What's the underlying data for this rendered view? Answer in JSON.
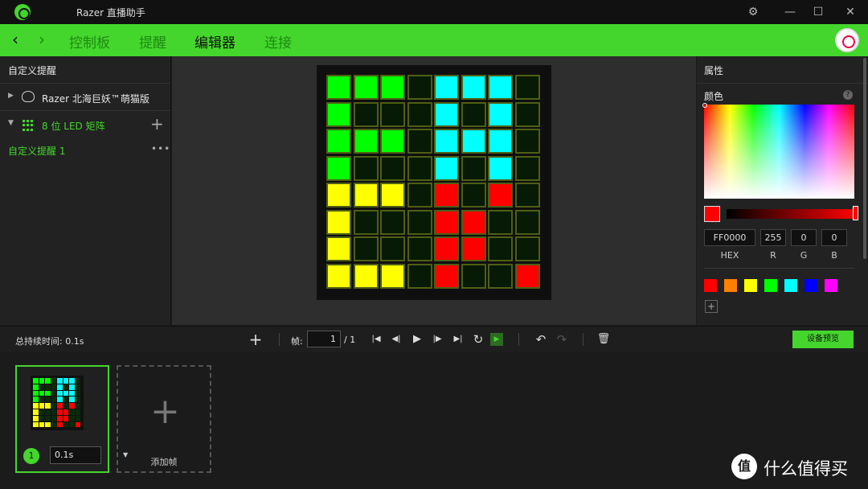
{
  "window": {
    "title": "Razer 直播助手",
    "controls": [
      "settings",
      "minimize",
      "maximize",
      "close"
    ]
  },
  "nav": {
    "tabs": [
      {
        "label": "控制板",
        "active": false
      },
      {
        "label": "提醒",
        "active": false
      },
      {
        "label": "编辑器",
        "active": true
      },
      {
        "label": "连接",
        "active": false
      }
    ]
  },
  "left_panel": {
    "header": "自定义提醒",
    "device": "Razer 北海巨妖™萌猫版",
    "matrix": "8 位 LED 矩阵",
    "alert": "自定义提醒 1"
  },
  "led_matrix": {
    "palette": {
      "G": "#00ff00",
      "C": "#00ffff",
      "Y": "#ffff00",
      "R": "#ff0000",
      "O": "#061a06"
    },
    "rows": [
      "GGGOCCCO",
      "GOOOCOCO",
      "GGGOCCCO",
      "GOOOCOCO",
      "YYYORORO",
      "YOOORROO",
      "YOOORROO",
      "YYYOROOR"
    ]
  },
  "right_panel": {
    "title": "属性",
    "color_label": "颜色",
    "help": "?",
    "current_color": "#ff0000",
    "hex": {
      "value": "FF0000",
      "label": "HEX"
    },
    "r": {
      "value": "255",
      "label": "R"
    },
    "g": {
      "value": "0",
      "label": "G"
    },
    "b": {
      "value": "0",
      "label": "B"
    },
    "presets": [
      "#ff0000",
      "#ff8000",
      "#ffff00",
      "#00ff00",
      "#00ffff",
      "#0000ff",
      "#ff00ff"
    ],
    "add_preset": "+"
  },
  "toolbar": {
    "total_duration": "总持续时间: 0.1s",
    "frame_label": "帧:",
    "frame_current": "1",
    "frame_total": "/ 1",
    "device_preview": "设备预览"
  },
  "frames": {
    "items": [
      {
        "number": "1",
        "duration": "0.1s"
      }
    ],
    "add_label": "添加帧"
  },
  "watermark": {
    "logo": "值",
    "text": "什么值得买"
  }
}
